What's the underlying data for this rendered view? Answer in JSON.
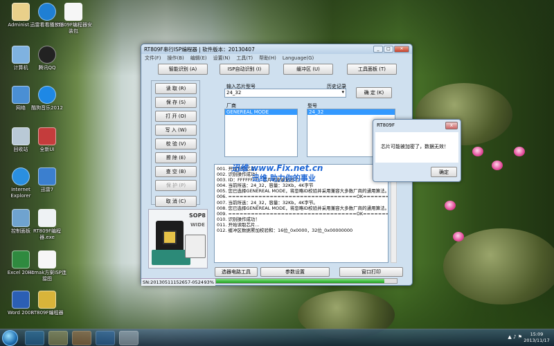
{
  "desktop_icons": [
    {
      "label": "Administ...",
      "icon": "user-folder-icon"
    },
    {
      "label": "迅雷看看播放器",
      "icon": "xunlei-icon"
    },
    {
      "label": "RT809F编程器安装包",
      "icon": "document-icon"
    },
    {
      "label": "计算机",
      "icon": "computer-icon"
    },
    {
      "label": "腾讯QQ",
      "icon": "qq-icon"
    },
    {
      "label": "网络",
      "icon": "network-icon"
    },
    {
      "label": "酷狗音乐2012",
      "icon": "kugou-icon"
    },
    {
      "label": "回收站",
      "icon": "recycle-bin-icon"
    },
    {
      "label": "全新UI",
      "icon": "app-icon"
    },
    {
      "label": "Internet Explorer",
      "icon": "ie-icon"
    },
    {
      "label": "迅雷7",
      "icon": "xunlei7-icon"
    },
    {
      "label": "控制面板",
      "icon": "control-panel-icon"
    },
    {
      "label": "RT809F编程器.exe",
      "icon": "programmer-icon"
    },
    {
      "label": "Excel 2003",
      "icon": "excel-icon"
    },
    {
      "label": "Hcmak方案ISP连接图",
      "icon": "document-icon"
    },
    {
      "label": "Word 2003",
      "icon": "word-icon"
    },
    {
      "label": "RT809F编程器",
      "icon": "programmer-icon"
    }
  ],
  "window": {
    "title": "RT809F串行ISP编程器 | 软件版本：20130407",
    "menu": [
      "文件(F)",
      "操作(B)",
      "编辑(E)",
      "设置(N)",
      "工具(T)",
      "帮助(H)",
      "Language(G)"
    ],
    "top_buttons": [
      "智能识别 (A)",
      "ISP自动识别 (I)",
      "缓冲区 (U)",
      "工具面板 (T)"
    ],
    "left_buttons": [
      {
        "label": "读 取 (R)",
        "enabled": true
      },
      {
        "label": "保 存 (S)",
        "enabled": true
      },
      {
        "label": "打 开 (O)",
        "enabled": true
      },
      {
        "label": "写 入 (W)",
        "enabled": true
      },
      {
        "label": "校 验 (V)",
        "enabled": true
      },
      {
        "label": "擦 除 (E)",
        "enabled": true
      },
      {
        "label": "查 空 (B)",
        "enabled": true
      },
      {
        "label": "保 护 (P)",
        "enabled": false
      }
    ],
    "cancel_button": "取 消 (C)",
    "chip_label": "SOP8",
    "chip_label2": "WIDE",
    "chip_input_label": "输入芯片型号",
    "chip_input_value": "24_32",
    "history_label": "历史记录",
    "confirm_button": "确 定 (K)",
    "vendor_label": "厂商",
    "vendor_selected": "GENEREAL MODE",
    "model_label": "型号",
    "model_selected": "24_32",
    "log": [
      "001. 开始识别芯片...",
      "002. 识别操作成功！",
      "003. ID：FFFFFFFF，芯片可能被加密了！",
      "004. 当前所选：24_32，容量：32Kb，4K字节",
      "005. 您已选择GENEREAL MODE，将忽略ID校验并采用兼容大多数厂商的通用算法。",
      "006. ==================================OK==================",
      "007. 当前所选：24_32，容量：32Kb，4K字节。",
      "008. 您已选择GENEREAL MODE，将忽略ID校验并采用兼容大多数厂商的通用算法。",
      "009. ==================================OK==================",
      "010. 识别操作成功！",
      "011. 开始读取芯片...",
      "012. 缓冲区数据累加校验和：16位_0x0000，32位_0x00000000"
    ],
    "watermark": "迅维  www.Fix.net.cn",
    "watermark2": "迅维 助力你的事业",
    "bottom_buttons": [
      "选器电路工具",
      "参数设置",
      "窗口打印"
    ],
    "status_sn": "SN:20130511152657-0524",
    "progress_text": "93%",
    "progress_value": 93
  },
  "dialog": {
    "title": "RT809F",
    "message": "芯片可能被加密了，数据无效！",
    "ok_button": "确定",
    "close_glyph": "x"
  },
  "taskbar": {
    "time": "15:09",
    "date": "2013/11/17"
  },
  "colors": {
    "accent": "#3399ff",
    "progress": "#1ea01e",
    "watermark": "#1e66d4"
  }
}
